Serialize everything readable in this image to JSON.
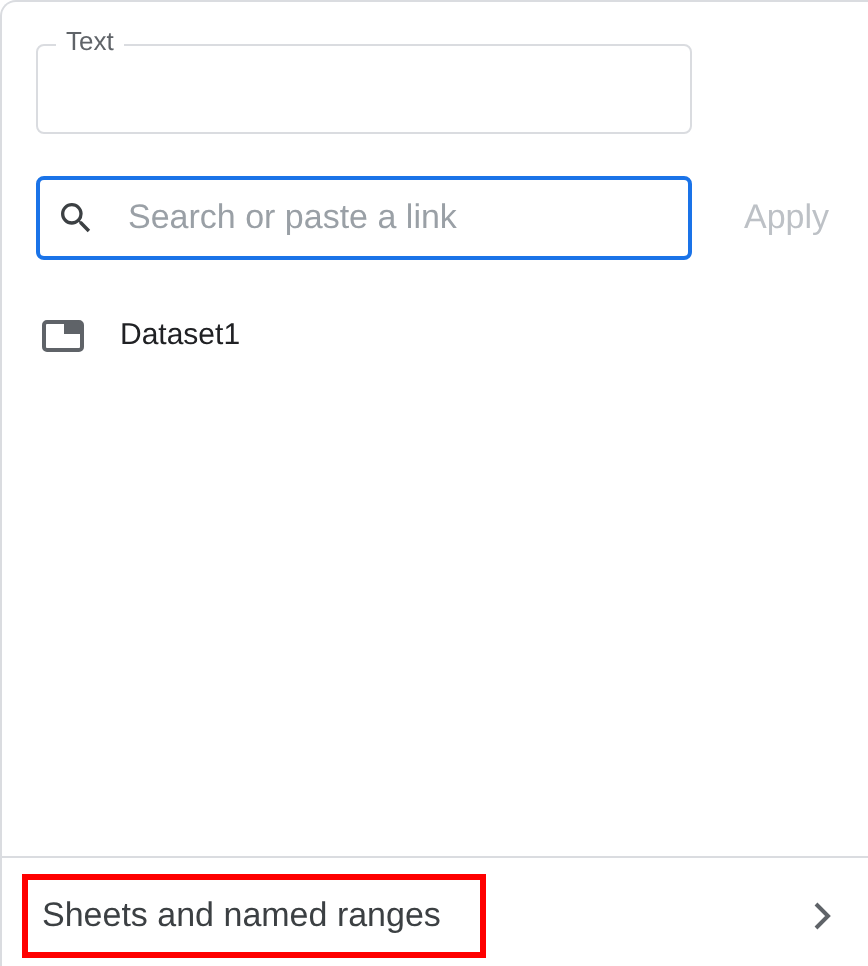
{
  "text_field": {
    "label": "Text"
  },
  "search": {
    "placeholder": "Search or paste a link",
    "focused": true
  },
  "apply_button": {
    "label": "Apply",
    "disabled": true
  },
  "items": [
    {
      "label": "Dataset1"
    }
  ],
  "footer": {
    "label": "Sheets and named ranges",
    "highlighted": true
  }
}
